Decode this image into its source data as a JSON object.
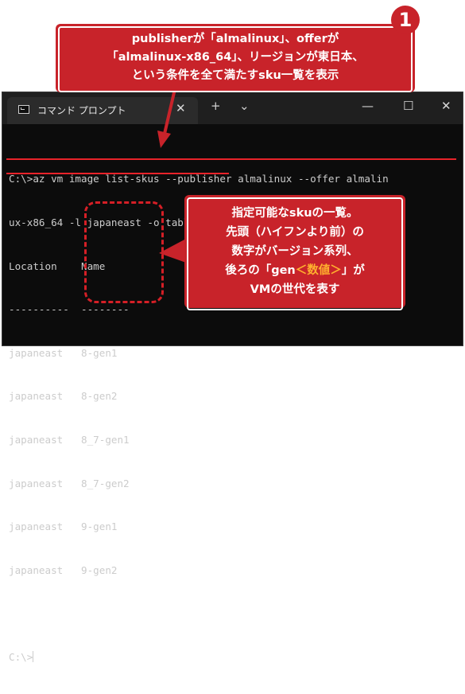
{
  "callout_top": {
    "lines": [
      "publisherが「almalinux」、offerが",
      "「almalinux-x86_64」、リージョンが東日本、",
      "という条件を全て満たすsku一覧を表示"
    ]
  },
  "badge_number": "1",
  "window": {
    "tab_title": "コマンド プロンプト",
    "tab_close": "✕",
    "new_tab": "+",
    "dropdown": "⌄",
    "minimize": "—",
    "maximize": "☐",
    "close": "✕"
  },
  "terminal": {
    "lines": [
      "C:\\>az vm image list-skus --publisher almalinux --offer almalin",
      "ux-x86_64 -l japaneast -o table",
      "Location    Name",
      "----------  --------",
      "japaneast   8-gen1",
      "japaneast   8-gen2",
      "japaneast   8_7-gen1",
      "japaneast   8_7-gen2",
      "japaneast   9-gen1",
      "japaneast   9-gen2",
      "",
      "C:\\>"
    ]
  },
  "callout_right": {
    "line1": "指定可能なskuの一覧。",
    "line2": "先頭（ハイフンより前）の",
    "line3": "数字がバージョン系列、",
    "line4_pre": "後ろの「gen",
    "line4_highlight": "＜数値＞",
    "line4_post": "」が",
    "line5": "VMの世代を表す"
  }
}
